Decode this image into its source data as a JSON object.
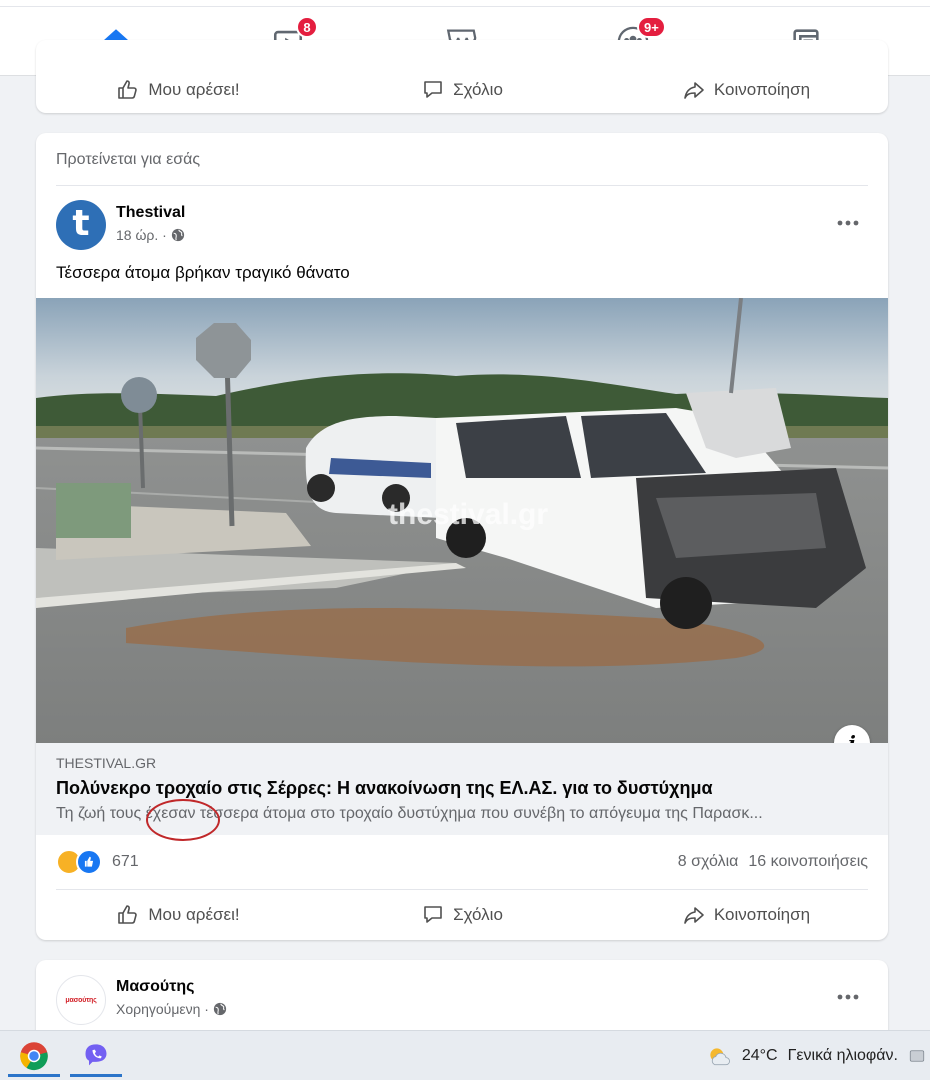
{
  "nav": {
    "tabs": [
      {
        "name": "home",
        "icon": "home-icon",
        "active": true
      },
      {
        "name": "watch",
        "icon": "video-icon",
        "badge": "8"
      },
      {
        "name": "marketplace",
        "icon": "store-icon"
      },
      {
        "name": "groups",
        "icon": "groups-icon",
        "badge": "9+"
      },
      {
        "name": "gaming",
        "icon": "gaming-icon"
      }
    ]
  },
  "actions": {
    "like": "Μου αρέσει!",
    "comment": "Σχόλιο",
    "share": "Κοινοποίηση"
  },
  "post": {
    "suggested_label": "Προτείνεται για εσάς",
    "author": "Thestival",
    "avatar_letter": "t",
    "time": "18 ώρ. ·",
    "text": "Τέσσερα άτομα βρήκαν τραγικό θάνατο",
    "image_watermark": "thestival.gr",
    "info_symbol": "i",
    "link": {
      "domain": "THESTIVAL.GR",
      "title": "Πολύνεκρο τροχαίο στις Σέρρες: Η ανακοίνωση της ΕΛ.ΑΣ. για το δυστύχημα",
      "description": "Τη ζωή τους έχεσαν τέσσερα άτομα στο τροχαίο δυστύχημα που συνέβη το απόγευμα της Παρασκ..."
    },
    "reactions_count": "671",
    "comments": "8 σχόλια",
    "shares": "16 κοινοποιήσεις"
  },
  "sponsored": {
    "author": "Μασούτης",
    "label": "Χορηγούμενη ·",
    "avatar_text": "μασούτης"
  },
  "taskbar": {
    "apps": [
      {
        "name": "chrome",
        "icon": "chrome-icon"
      },
      {
        "name": "viber",
        "icon": "viber-icon"
      }
    ],
    "weather_temp": "24°C",
    "weather_text": "Γενικά ηλιοφάν."
  },
  "colors": {
    "accent": "#1877f2",
    "badge": "#e41e3f",
    "annotation": "#c0282a"
  }
}
